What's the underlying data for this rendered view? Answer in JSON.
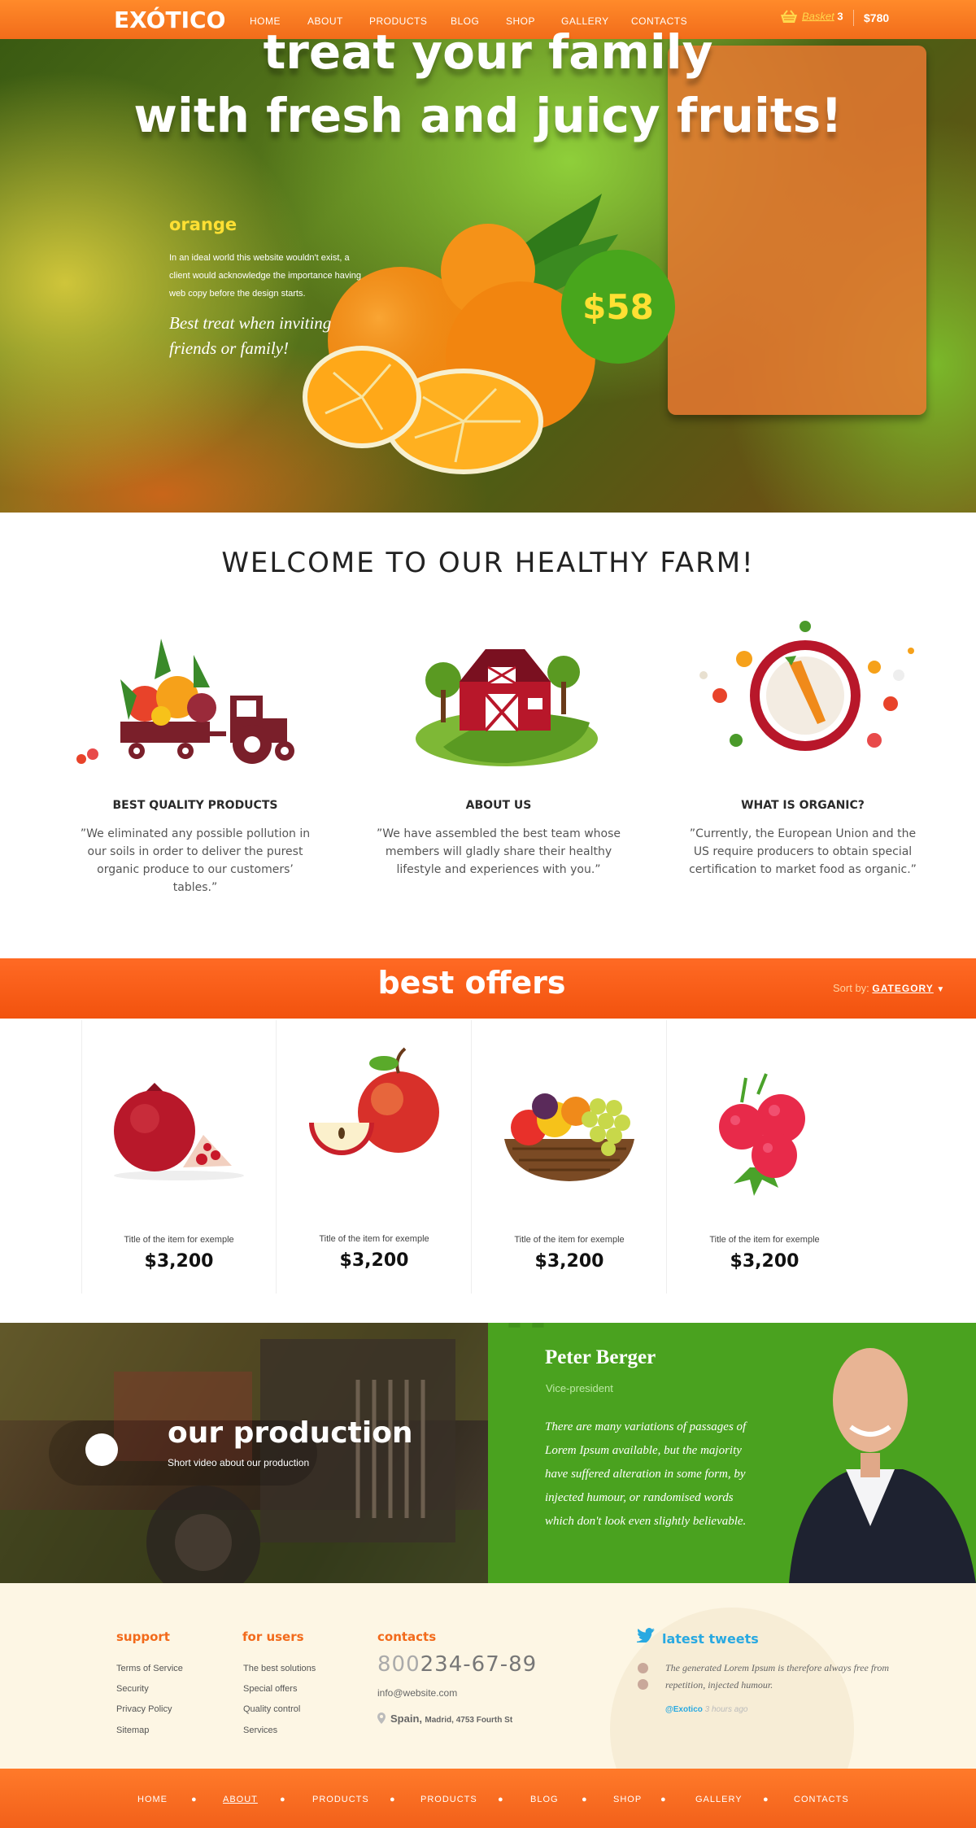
{
  "header": {
    "logo": "EXÓTICO",
    "nav": [
      "HOME",
      "ABOUT",
      "PRODUCTS",
      "BLOG",
      "SHOP",
      "GALLERY",
      "CONTACTS"
    ],
    "basket_label": "Basket",
    "basket_count": "3",
    "basket_total": "$780"
  },
  "hero": {
    "headline_1": "treat your family",
    "headline_2": "with fresh and juicy fruits!",
    "product_name": "orange",
    "product_desc": "In an ideal world this website wouldn't exist, a client would acknowledge the importance having web copy before the design starts.",
    "product_tagline": "Best treat when inviting friends or family!",
    "price": "$58"
  },
  "welcome": {
    "title": "WELCOME TO OUR HEALTHY FARM!",
    "features": [
      {
        "title": "BEST QUALITY PRODUCTS",
        "text": "”We eliminated any possible pollution in our soils in order to deliver the purest organic produce to our customers’ tables.”"
      },
      {
        "title": "ABOUT US",
        "text": "”We have assembled the best team whose members will gladly share their healthy lifestyle and experiences with you.”"
      },
      {
        "title": "WHAT IS ORGANIC?",
        "text": "”Currently, the European Union and the US require producers to obtain special certification to market food as organic.”"
      }
    ]
  },
  "offers": {
    "title": "best offers",
    "sort_label": "Sort by:",
    "sort_value": "GATEGORY",
    "items": [
      {
        "title": "Title of the item for exemple",
        "price": "$3,200",
        "icon": "pomegranate-image"
      },
      {
        "title": "Title of the item for exemple",
        "price": "$3,200",
        "icon": "apple-image"
      },
      {
        "title": "Title of the item for exemple",
        "price": "$3,200",
        "icon": "fruit-basket-image"
      },
      {
        "title": "Title of the item for exemple",
        "price": "$3,200",
        "icon": "raspberry-image"
      }
    ]
  },
  "production": {
    "title": "our production",
    "subtitle": "Short video about our production"
  },
  "testimonial": {
    "name": "Peter Berger",
    "role": "Vice-president",
    "quote": "There are many variations of passages of Lorem Ipsum available, but the majority have suffered alteration in some form, by injected humour, or randomised words which don't look even slightly believable."
  },
  "footer": {
    "support": {
      "title": "support",
      "links": [
        "Terms of Service",
        "Security",
        "Privacy Policy",
        "Sitemap"
      ]
    },
    "for_users": {
      "title": "for users",
      "links": [
        "The best solutions",
        "Special offers",
        "Quality control",
        "Services"
      ]
    },
    "contacts": {
      "title": "contacts",
      "phone_prefix": "800",
      "phone_rest": "234-67-89",
      "email": "info@website.com",
      "country": "Spain,",
      "address": "Madrid, 4753 Fourth St"
    },
    "tweets": {
      "title": "latest tweets",
      "text": "The generated Lorem Ipsum is therefore always free from repetition, injected humour.",
      "user": "@Exotico",
      "time": "3 hours ago"
    }
  },
  "bottom_nav": [
    "HOME",
    "ABOUT",
    "PRODUCTS",
    "PRODUCTS",
    "BLOG",
    "SHOP",
    "GALLERY",
    "CONTACTS"
  ],
  "colors": {
    "accent": "#f26a1b",
    "green": "#4aa21f",
    "yellow": "#ffe033",
    "twitter": "#29a9e1"
  }
}
